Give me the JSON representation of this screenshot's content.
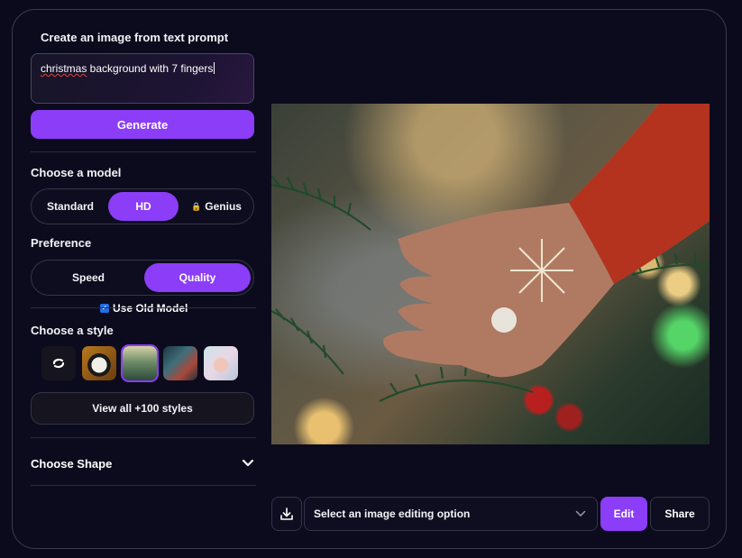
{
  "prompt": {
    "label": "Create an image from text prompt",
    "value_word1": "christmas",
    "value_rest": " background with 7 fingers"
  },
  "generate_label": "Generate",
  "model": {
    "label": "Choose a model",
    "options": [
      "Standard",
      "HD",
      "Genius"
    ],
    "selected": "HD",
    "genius_locked": true
  },
  "preference": {
    "label": "Preference",
    "options": [
      "Speed",
      "Quality"
    ],
    "selected": "Quality"
  },
  "use_old_model": {
    "label": "Use Old Model",
    "checked": true
  },
  "style": {
    "label": "Choose a style",
    "thumbnails": [
      "no-style",
      "panda",
      "forest",
      "robot",
      "anime-girl"
    ],
    "selected": "forest",
    "view_all_label": "View all +100 styles"
  },
  "shape": {
    "label": "Choose Shape"
  },
  "editing": {
    "select_placeholder": "Select an image editing option",
    "edit_label": "Edit",
    "share_label": "Share"
  },
  "colors": {
    "accent": "#8b3df7",
    "background": "#0b0a1c",
    "border": "#34334a"
  }
}
